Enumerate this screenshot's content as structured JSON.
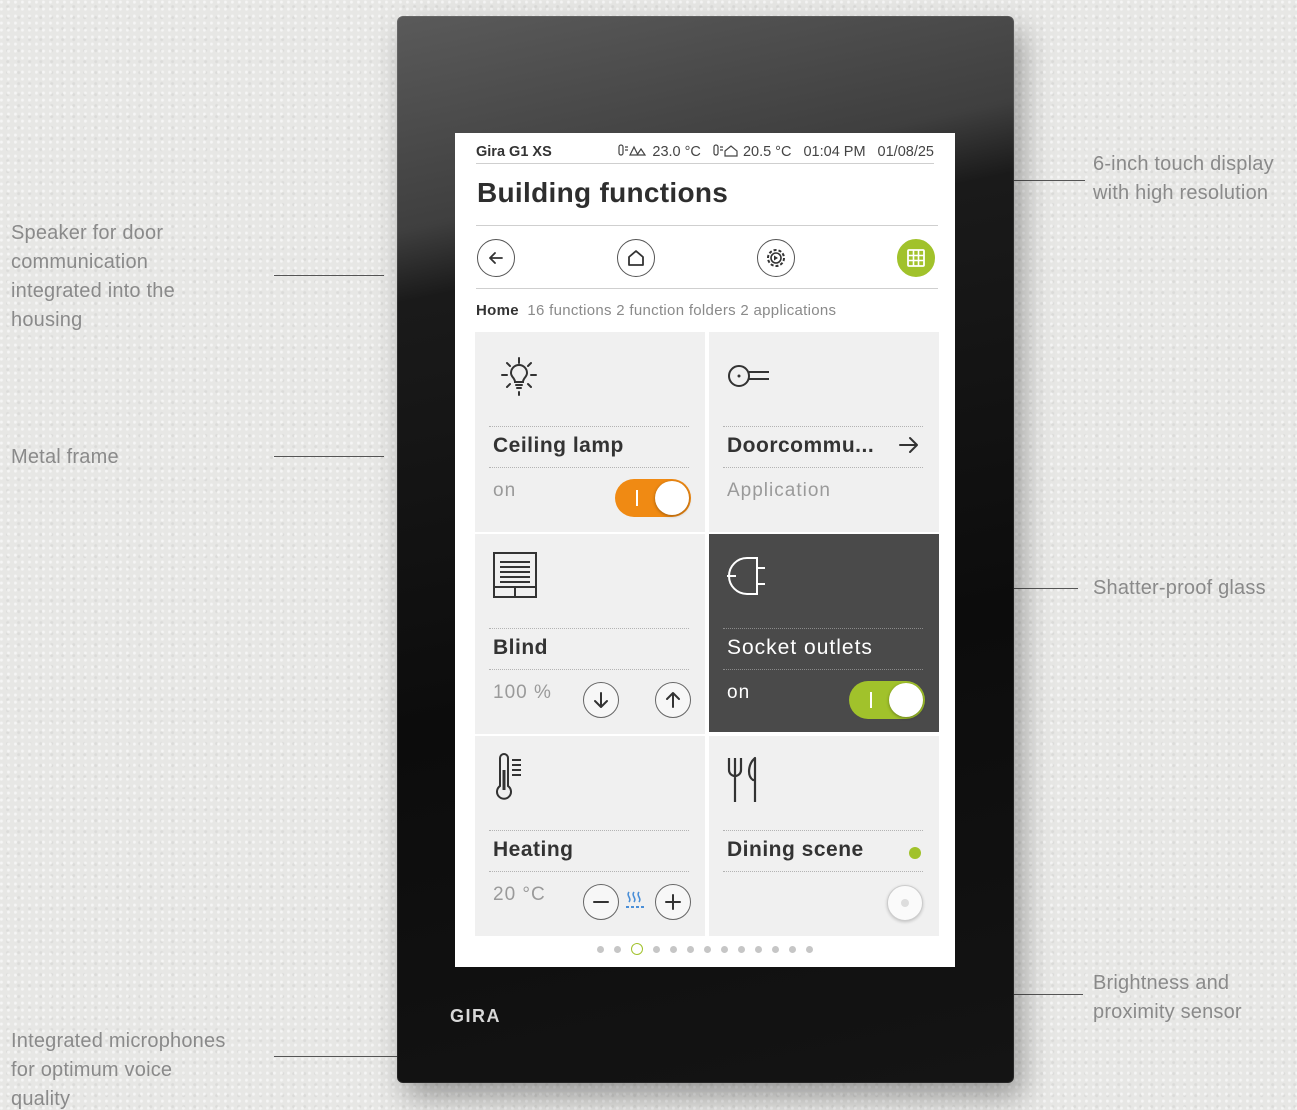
{
  "callouts": {
    "display": [
      "6-inch touch display",
      "with high resolution"
    ],
    "speaker": [
      "Speaker for door",
      "communication",
      "integrated into the",
      "housing"
    ],
    "metal_frame": "Metal frame",
    "glass": "Shatter-proof glass",
    "sensor": [
      "Brightness and",
      "proximity sensor"
    ],
    "microphones": [
      "Integrated microphones",
      "for optimum voice",
      "quality"
    ]
  },
  "device": {
    "brand": "GIRA"
  },
  "statusbar": {
    "device_name": "Gira G1 XS",
    "outdoor_temp": "23.0 °C",
    "indoor_temp": "20.5 °C",
    "time": "01:04 PM",
    "date": "01/08/25"
  },
  "header": {
    "title": "Building functions"
  },
  "nav": {
    "icons": [
      "back-arrow-icon",
      "home-icon",
      "settings-gear-icon",
      "grid-view-icon"
    ],
    "active": "grid-view",
    "accent_color": "#a1c22b"
  },
  "breadcrumb": {
    "location": "Home",
    "summary": "16 functions 2 function folders 2 applications"
  },
  "tiles": [
    {
      "name": "Ceiling lamp",
      "state": "on",
      "icon": "bulb-icon",
      "toggle_color": "#f08a13"
    },
    {
      "name": "Doorcommu...",
      "state": "Application",
      "icon": "key-icon"
    },
    {
      "name": "Blind",
      "state": "100 %",
      "icon": "blind-icon"
    },
    {
      "name": "Socket outlets",
      "state": "on",
      "icon": "plug-icon",
      "toggle_color": "#a1c22b"
    },
    {
      "name": "Heating",
      "state": "20 °C",
      "icon": "thermometer-icon"
    },
    {
      "name": "Dining scene",
      "state": "",
      "icon": "cutlery-icon",
      "indicator_color": "#a1c22b"
    }
  ],
  "pager": {
    "pages": 13,
    "current": 3
  }
}
